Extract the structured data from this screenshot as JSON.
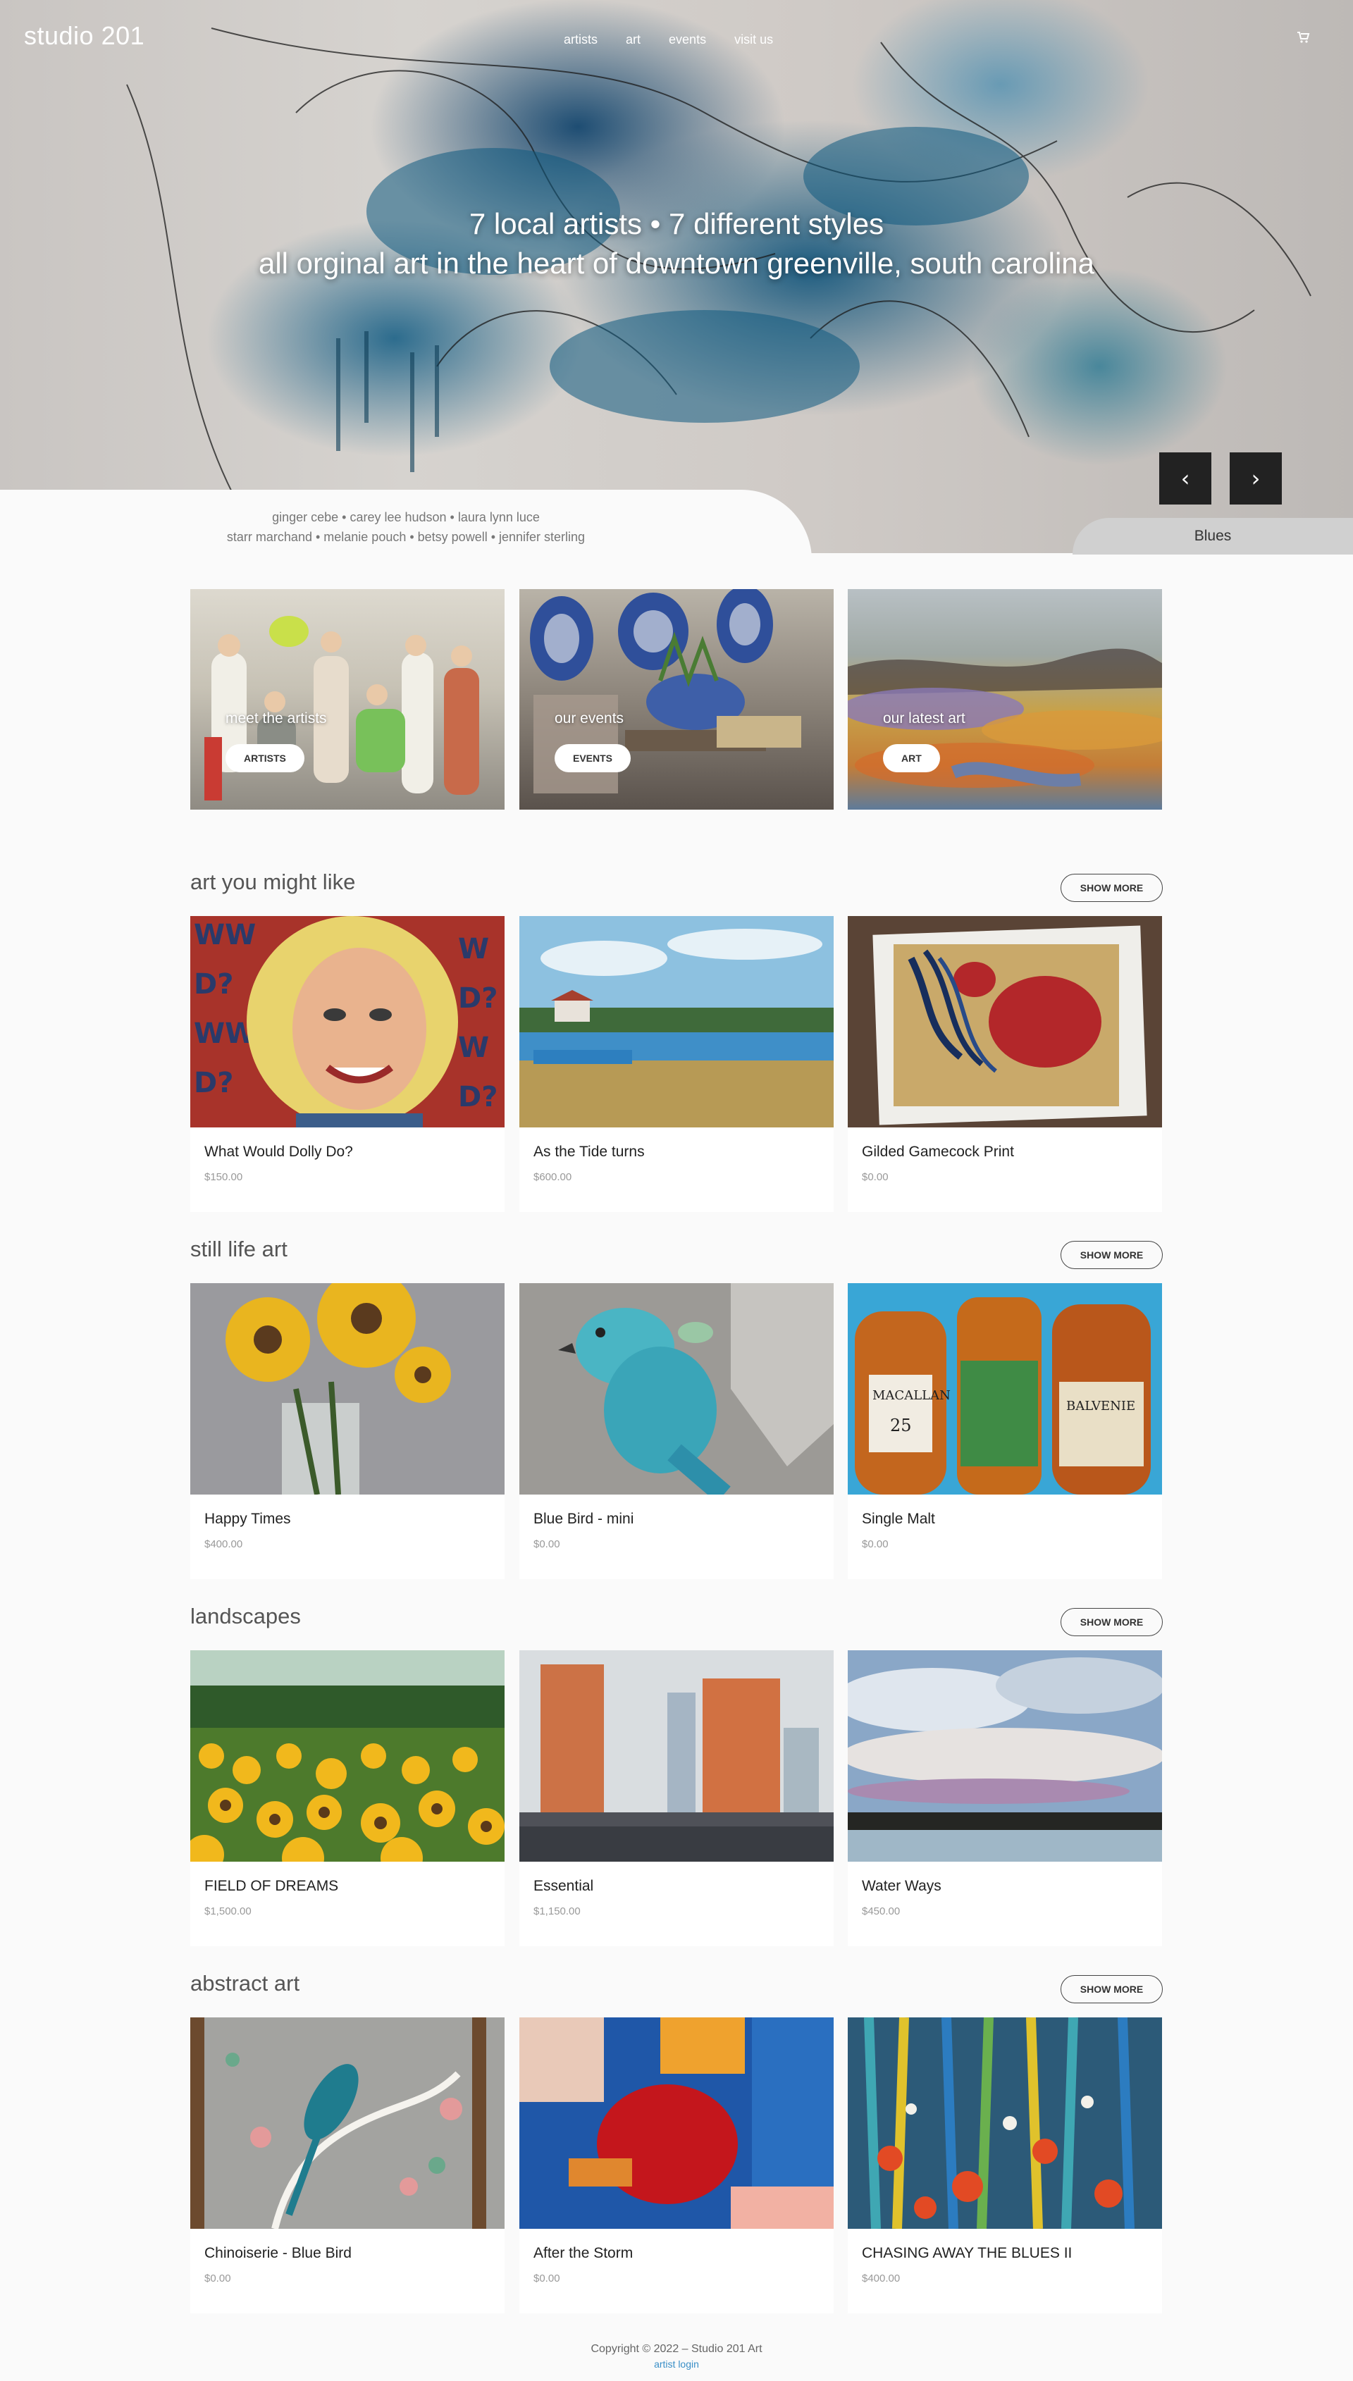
{
  "header": {
    "logo": "studio 201",
    "nav": [
      {
        "label": "artists"
      },
      {
        "label": "art"
      },
      {
        "label": "events"
      },
      {
        "label": "visit us"
      }
    ],
    "cart_icon": "cart-icon"
  },
  "hero": {
    "line1": "7 local artists • 7 different styles",
    "line2": "all orginal art in the heart of downtown greenville, south carolina",
    "artists_line1": "ginger cebe • carey lee hudson • laura lynn luce",
    "artists_line2": "starr marchand • melanie pouch • betsy powell • jennifer sterling",
    "slide_title": "Blues",
    "prev": "‹",
    "next": "›"
  },
  "features": [
    {
      "label": "meet the artists",
      "button": "ARTISTS"
    },
    {
      "label": "our events",
      "button": "EVENTS"
    },
    {
      "label": "our latest art",
      "button": "ART"
    }
  ],
  "sections": [
    {
      "title": "art you might like",
      "show_more": "SHOW MORE",
      "items": [
        {
          "title": "What Would Dolly Do?",
          "price": "$150.00"
        },
        {
          "title": "As the Tide turns",
          "price": "$600.00"
        },
        {
          "title": "Gilded Gamecock Print",
          "price": "$0.00"
        }
      ]
    },
    {
      "title": "still life art",
      "show_more": "SHOW MORE",
      "items": [
        {
          "title": "Happy Times",
          "price": "$400.00"
        },
        {
          "title": "Blue Bird - mini",
          "price": "$0.00"
        },
        {
          "title": "Single Malt",
          "price": "$0.00"
        }
      ]
    },
    {
      "title": "landscapes",
      "show_more": "SHOW MORE",
      "items": [
        {
          "title": "FIELD OF DREAMS",
          "price": "$1,500.00"
        },
        {
          "title": "Essential",
          "price": "$1,150.00"
        },
        {
          "title": "Water Ways",
          "price": "$450.00"
        }
      ]
    },
    {
      "title": "abstract art",
      "show_more": "SHOW MORE",
      "items": [
        {
          "title": "Chinoiserie - Blue Bird",
          "price": "$0.00"
        },
        {
          "title": "After the Storm",
          "price": "$0.00"
        },
        {
          "title": "CHASING AWAY THE BLUES II",
          "price": "$400.00"
        }
      ]
    }
  ],
  "footer": {
    "copyright": "Copyright © 2022 – Studio 201 Art",
    "login": "artist login"
  }
}
